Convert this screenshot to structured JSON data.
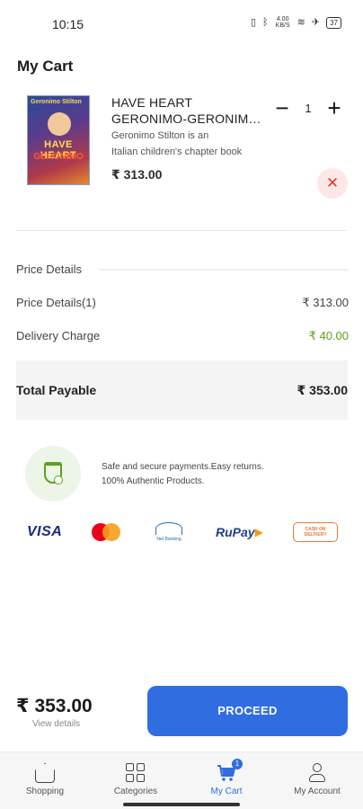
{
  "status_bar": {
    "time": "10:15",
    "icons": [
      "vibrate-icon",
      "bluetooth-icon",
      "data-speed-icon",
      "wifi-icon",
      "airplane-icon",
      "battery-icon"
    ],
    "data_speed": "4.00 KB/S",
    "battery": "37"
  },
  "page": {
    "title": "My Cart"
  },
  "cart_item": {
    "title_line1": "HAVE HEART",
    "title_line2": "GERONIMO-GERONIMO STILTON",
    "description_line1": "Geronimo Stilton is an",
    "description_line2": "Italian children's chapter book",
    "price": "₹ 313.00",
    "quantity": "1",
    "minus_symbol": "−",
    "plus_symbol": "+",
    "remove_symbol": "✕",
    "cover": {
      "top_text": "Geronimo Stilton",
      "title_1": "HAVE HEART",
      "title_2": "GERONIMO"
    }
  },
  "price_details": {
    "heading": "Price Details",
    "items_label": "Price Details(1)",
    "items_value": "₹ 313.00",
    "delivery_label": "Delivery Charge",
    "delivery_value": "₹ 40.00",
    "total_label": "Total Payable",
    "total_value": "₹ 353.00"
  },
  "secure": {
    "line1": "Safe and secure payments.Easy returns.",
    "line2": "100% Authentic Products."
  },
  "payment_methods": {
    "visa": "VISA",
    "netbanking": "Net Banking",
    "rupay": "RuPay",
    "cod": "CASH ON DELIVERY"
  },
  "checkout": {
    "total": "₹ 353.00",
    "view_details": "View details",
    "proceed": "PROCEED"
  },
  "bottom_nav": {
    "items": [
      {
        "label": "Shopping"
      },
      {
        "label": "Categories"
      },
      {
        "label": "My Cart",
        "badge": "1"
      },
      {
        "label": "My Account"
      }
    ],
    "active_color": "#2f6de1"
  },
  "colors": {
    "accent": "#2f6de1",
    "delivery_green": "#5aa31b",
    "remove_red": "#e53935"
  }
}
